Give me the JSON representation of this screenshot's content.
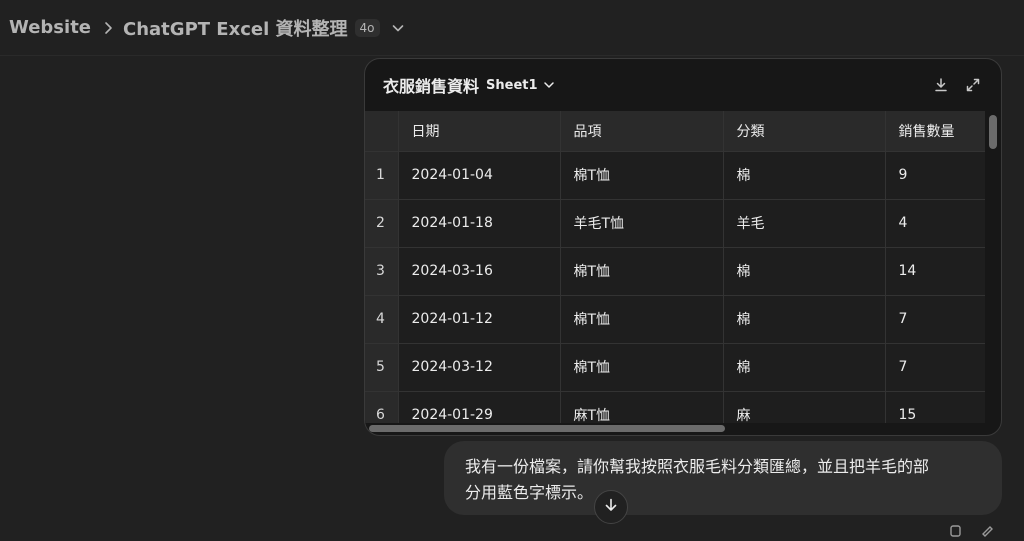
{
  "header": {
    "breadcrumb_first": "Website",
    "title": "ChatGPT Excel 資料整理",
    "model_badge": "4o"
  },
  "sheet": {
    "title": "衣服銷售資料",
    "sheet_name": "Sheet1",
    "columns": [
      "日期",
      "品項",
      "分類",
      "銷售數量"
    ],
    "rows": [
      {
        "n": "1",
        "date": "2024-01-04",
        "item": "棉T恤",
        "category": "棉",
        "qty": "9"
      },
      {
        "n": "2",
        "date": "2024-01-18",
        "item": "羊毛T恤",
        "category": "羊毛",
        "qty": "4"
      },
      {
        "n": "3",
        "date": "2024-03-16",
        "item": "棉T恤",
        "category": "棉",
        "qty": "14"
      },
      {
        "n": "4",
        "date": "2024-01-12",
        "item": "棉T恤",
        "category": "棉",
        "qty": "7"
      },
      {
        "n": "5",
        "date": "2024-03-12",
        "item": "棉T恤",
        "category": "棉",
        "qty": "7"
      },
      {
        "n": "6",
        "date": "2024-01-29",
        "item": "麻T恤",
        "category": "麻",
        "qty": "15"
      }
    ]
  },
  "message": {
    "line1": "我有一份檔案，請你幫我按照衣服毛料分類匯總，並且把羊毛的部",
    "line2": "分用藍色字標示。"
  },
  "icons": {
    "breadcrumb_sep": "chevron-right-icon",
    "model_menu": "chevron-down-icon",
    "download": "download-icon",
    "expand": "expand-icon",
    "scroll_down": "arrow-down-icon"
  }
}
